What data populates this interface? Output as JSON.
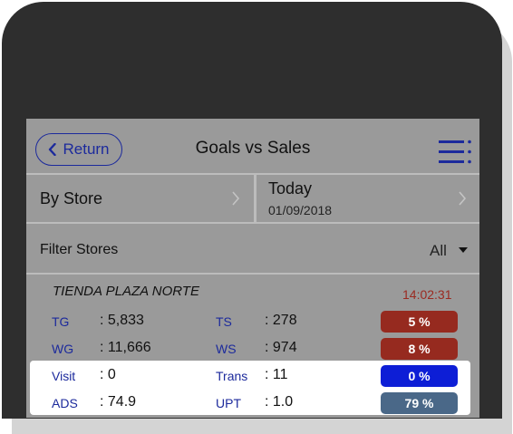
{
  "header": {
    "return_label": "Return",
    "title": "Goals vs Sales"
  },
  "selectors": {
    "store_label": "By Store",
    "date_label": "Today",
    "date_value": "01/09/2018"
  },
  "filter": {
    "label": "Filter Stores",
    "value": "All"
  },
  "store": {
    "name": "TIENDA PLAZA NORTE",
    "time": "14:02:31",
    "rows": [
      {
        "l1": "TG",
        "v1": ": 5,833",
        "l2": "TS",
        "v2": ": 278",
        "badge": "5 %",
        "badge_color": "#962a1f"
      },
      {
        "l1": "WG",
        "v1": ": 11,666",
        "l2": "WS",
        "v2": ": 974",
        "badge": "8 %",
        "badge_color": "#962a1f"
      },
      {
        "l1": "Visit",
        "v1": ": 0",
        "l2": "Trans",
        "v2": ": 11",
        "badge": "0 %",
        "badge_color": "#0d1ed6"
      },
      {
        "l1": "ADS",
        "v1": ": 74.9",
        "l2": "UPT",
        "v2": ": 1.0",
        "badge": "79 %",
        "badge_color": "#4a6888"
      }
    ]
  },
  "icons": {
    "return": "chevron-left-icon",
    "menu": "list-menu-icon",
    "store_arrow": "chevron-right-icon",
    "date_arrow": "chevron-right-icon",
    "filter_caret": "caret-down-icon"
  },
  "colors": {
    "accent": "#1c2a9c",
    "time": "#9b2a21",
    "device": "#2e2e2e",
    "screen": "#9a9a9a"
  }
}
